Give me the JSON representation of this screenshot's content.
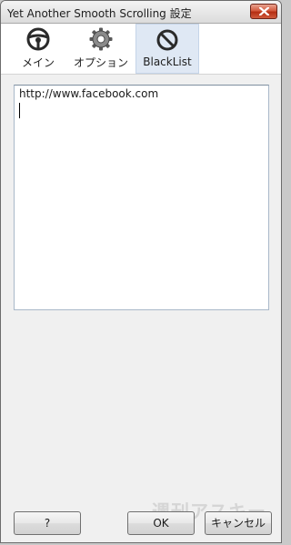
{
  "window": {
    "title": "Yet Another Smooth Scrolling 設定"
  },
  "tabs": [
    {
      "label": "メイン",
      "icon": "steering-wheel-icon"
    },
    {
      "label": "オプション",
      "icon": "gear-icon"
    },
    {
      "label": "BlackList",
      "icon": "prohibited-icon",
      "selected": true
    }
  ],
  "blacklist": {
    "value": "http://www.facebook.com"
  },
  "buttons": {
    "help": "?",
    "ok": "OK",
    "cancel": "キャンセル"
  },
  "watermark": "週刊アスキー",
  "colors": {
    "selected_tab": "#dfe8f4",
    "close_button": "#c9442a"
  }
}
